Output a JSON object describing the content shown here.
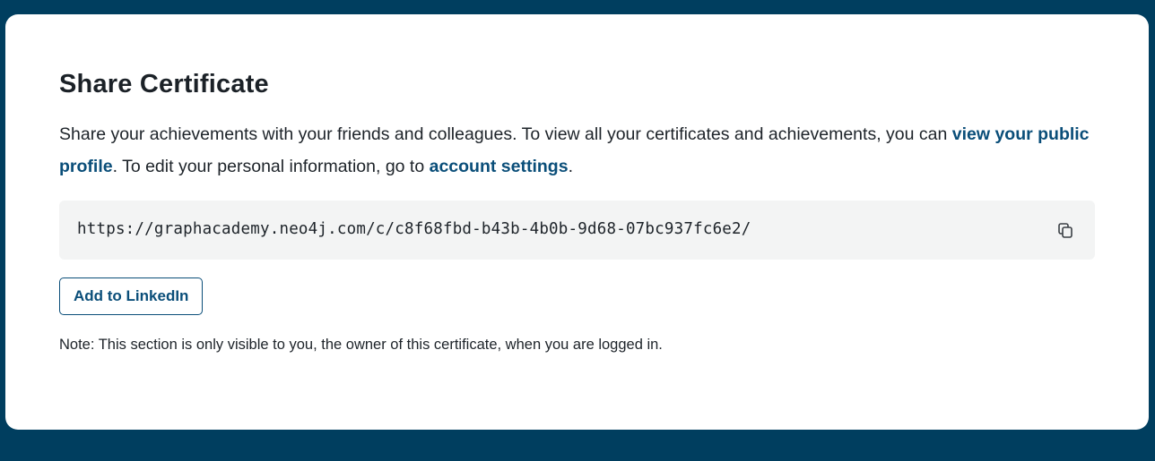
{
  "share": {
    "title": "Share Certificate",
    "description_part1": "Share your achievements with your friends and colleagues. To view all your certificates and achievements, you can ",
    "profile_link": "view your public profile",
    "description_part2": ". To edit your personal information, go to ",
    "settings_link": "account settings",
    "description_part3": ".",
    "url": "https://graphacademy.neo4j.com/c/c8f68fbd-b43b-4b0b-9d68-07bc937fc6e2/",
    "copy_icon": "copy-icon",
    "linkedin_button": "Add to LinkedIn",
    "note": "Note: This section is only visible to you, the owner of this certificate, when you are logged in."
  },
  "colors": {
    "background": "#003e5f",
    "card": "#ffffff",
    "link": "#0a4e79",
    "url_box": "#f3f4f4"
  }
}
